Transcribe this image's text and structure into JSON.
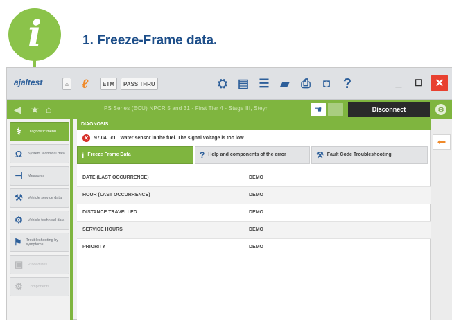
{
  "callout": {
    "badge_glyph": "i",
    "title": "1. Freeze-Frame data."
  },
  "titlebar": {
    "brand": "ajaltest",
    "chips": [
      "ETM",
      "PASS THRU"
    ],
    "toolbar_icons": [
      "engine-icon",
      "document-icon",
      "list-icon",
      "car-icon",
      "printer-icon",
      "camera-icon",
      "help-icon"
    ],
    "help_label": "?"
  },
  "navbar": {
    "path_text": "PS Series (ECU) NPCR 5 and 31 - First Tier 4 - Stage III, Steyr",
    "disconnect_label": "Disconnect"
  },
  "sidebar": {
    "items": [
      {
        "label": "Diagnostic menu",
        "icon": "stethoscope-icon",
        "active": true,
        "enabled": true
      },
      {
        "label": "System technical data",
        "icon": "ohm-icon",
        "active": false,
        "enabled": true
      },
      {
        "label": "Measures",
        "icon": "plug-icon",
        "active": false,
        "enabled": true
      },
      {
        "label": "Vehicle service data",
        "icon": "wrench-icon",
        "active": false,
        "enabled": true
      },
      {
        "label": "Vehicle technical data",
        "icon": "tools-icon",
        "active": false,
        "enabled": true
      },
      {
        "label": "Troubleshooting by symptoms",
        "icon": "troubleshoot-icon",
        "active": false,
        "enabled": true
      },
      {
        "label": "Procedures",
        "icon": "procedure-icon",
        "active": false,
        "enabled": false
      },
      {
        "label": "Components",
        "icon": "component-icon",
        "active": false,
        "enabled": false
      }
    ]
  },
  "main": {
    "section_title": "DIAGNOSIS",
    "error": {
      "code": "97.04",
      "qualifier": "c1",
      "message": "Water sensor in the fuel. The signal voltage is too low"
    },
    "tabs": [
      {
        "label": "Freeze Frame Data",
        "icon": "info-icon",
        "glyph": "i",
        "active": true
      },
      {
        "label": "Help and components of the error",
        "icon": "help-icon",
        "glyph": "?",
        "active": false
      },
      {
        "label": "Fault Code Troubleshooting",
        "icon": "troubleshoot-icon",
        "glyph": "⚒",
        "active": false
      }
    ],
    "freeze_frame": {
      "rows": [
        {
          "name": "DATE (LAST OCCURRENCE)",
          "value": "DEMO"
        },
        {
          "name": "HOUR (LAST OCCURRENCE)",
          "value": "DEMO"
        },
        {
          "name": "DISTANCE TRAVELLED",
          "value": "DEMO"
        },
        {
          "name": "SERVICE HOURS",
          "value": "DEMO"
        },
        {
          "name": "PRIORITY",
          "value": "DEMO"
        }
      ]
    }
  },
  "colors": {
    "accent_green": "#7fb53f",
    "badge_green": "#8bc34a",
    "title_blue": "#1d4e89",
    "error_red": "#d7322a",
    "back_orange": "#f08a2a",
    "close_red": "#e8402f"
  }
}
